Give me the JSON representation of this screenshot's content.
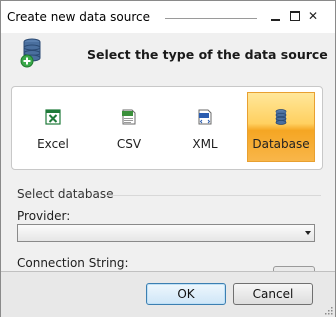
{
  "window": {
    "title": "Create new data source",
    "controls": [
      "minimize-icon",
      "maximize-icon",
      "close-icon"
    ],
    "close_glyph": "✕"
  },
  "header": {
    "icon": "database-add-icon",
    "heading": "Select the type of the data source"
  },
  "source_types": {
    "items": [
      {
        "label": "Excel",
        "icon": "excel-file-icon",
        "selected": false
      },
      {
        "label": "CSV",
        "icon": "csv-file-icon",
        "selected": false
      },
      {
        "label": "XML",
        "icon": "xml-file-icon",
        "selected": false
      },
      {
        "label": "Database",
        "icon": "database-icon",
        "selected": true
      }
    ],
    "selected_color": "#f5a623"
  },
  "database": {
    "group_title": "Select database",
    "provider_label": "Provider:",
    "provider_value": "",
    "connection_label": "Connection String:"
  },
  "footer": {
    "ok_label": "OK",
    "cancel_label": "Cancel"
  },
  "colors": {
    "accent": "#3c7fb1",
    "selection": "#ffd060",
    "excel_green": "#1f7a3a",
    "xml_blue": "#2b5db0",
    "db_blue": "#3a5d8c"
  }
}
